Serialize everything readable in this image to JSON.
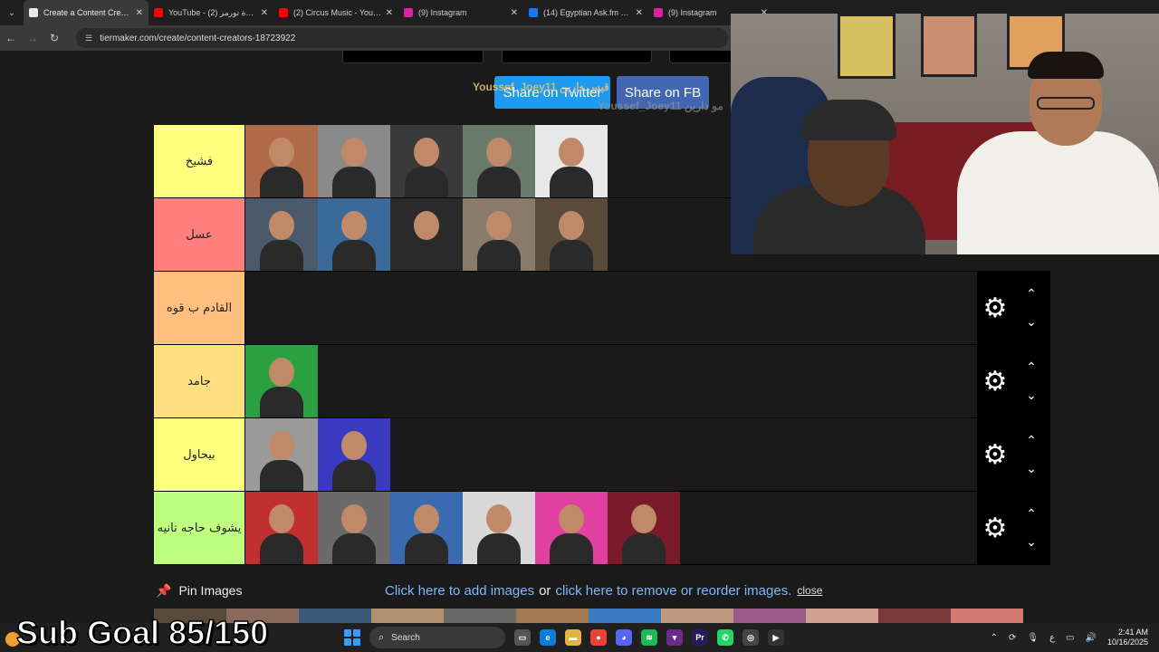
{
  "browser": {
    "tabs": [
      {
        "label": "Create a Content Creator",
        "color": "#e8e8e8",
        "active": true
      },
      {
        "label": "YouTube - قعدة تورمز (2)",
        "color": "#ff0000",
        "active": false
      },
      {
        "label": "(2) Circus Music - YouTub",
        "color": "#ff0000",
        "active": false
      },
      {
        "label": "(9) Instagram",
        "color": "#d6249f",
        "active": false
      },
      {
        "label": "(14) Egyptian Ask.fm Vide",
        "color": "#1877f2",
        "active": false
      },
      {
        "label": "(9) Instagram",
        "color": "#d6249f",
        "active": false
      }
    ],
    "url": "tiermaker.com/create/content-creators-18723922"
  },
  "share": {
    "twitter": "Share on Twitter",
    "facebook": "Share on FB",
    "overlay_name": "Youssef_Joey11 قيس دارين",
    "overlay_name_faded": "Youssef_Joey11 مو دارين"
  },
  "tiers": [
    {
      "label": "فشيخ",
      "color": "#ffff7f",
      "items": [
        "#b06a4a",
        "#8a8a8a",
        "#3a3a3a",
        "#6a7a6a",
        "#e8e8e8"
      ],
      "controls": false
    },
    {
      "label": "عسل",
      "color": "#ff7f7f",
      "items": [
        "#4a5a6a",
        "#3a6a9a",
        "#2a2a2a",
        "#8a7a6a",
        "#5a4a3a"
      ],
      "controls": false
    },
    {
      "label": "القادم ب قوه",
      "color": "#ffbf7f",
      "items": [],
      "controls": true
    },
    {
      "label": "جامد",
      "color": "#ffdf7f",
      "items": [
        "#2aa040"
      ],
      "controls": true
    },
    {
      "label": "بيحاول",
      "color": "#ffff7f",
      "items": [
        "#9a9a9a",
        "#3a3ac0"
      ],
      "controls": true
    },
    {
      "label": "يشوف حاجه تانيه",
      "color": "#bfff7f",
      "items": [
        "#c03030",
        "#6a6a6a",
        "#3a6ab0",
        "#d8d8d8",
        "#e040a0",
        "#7a1a2a"
      ],
      "controls": true
    }
  ],
  "pin": {
    "icon": "pushpin-icon",
    "label": "Pin Images",
    "add_link": "Click here to add images",
    "or": "or",
    "reorder_link": "click here to remove or reorder images.",
    "close": "close"
  },
  "overlay": {
    "sub_goal": "Sub Goal 85/150"
  },
  "taskbar": {
    "search_label": "Search",
    "time": "2:41 AM",
    "date": "10/16/2025",
    "lang": "ع"
  }
}
